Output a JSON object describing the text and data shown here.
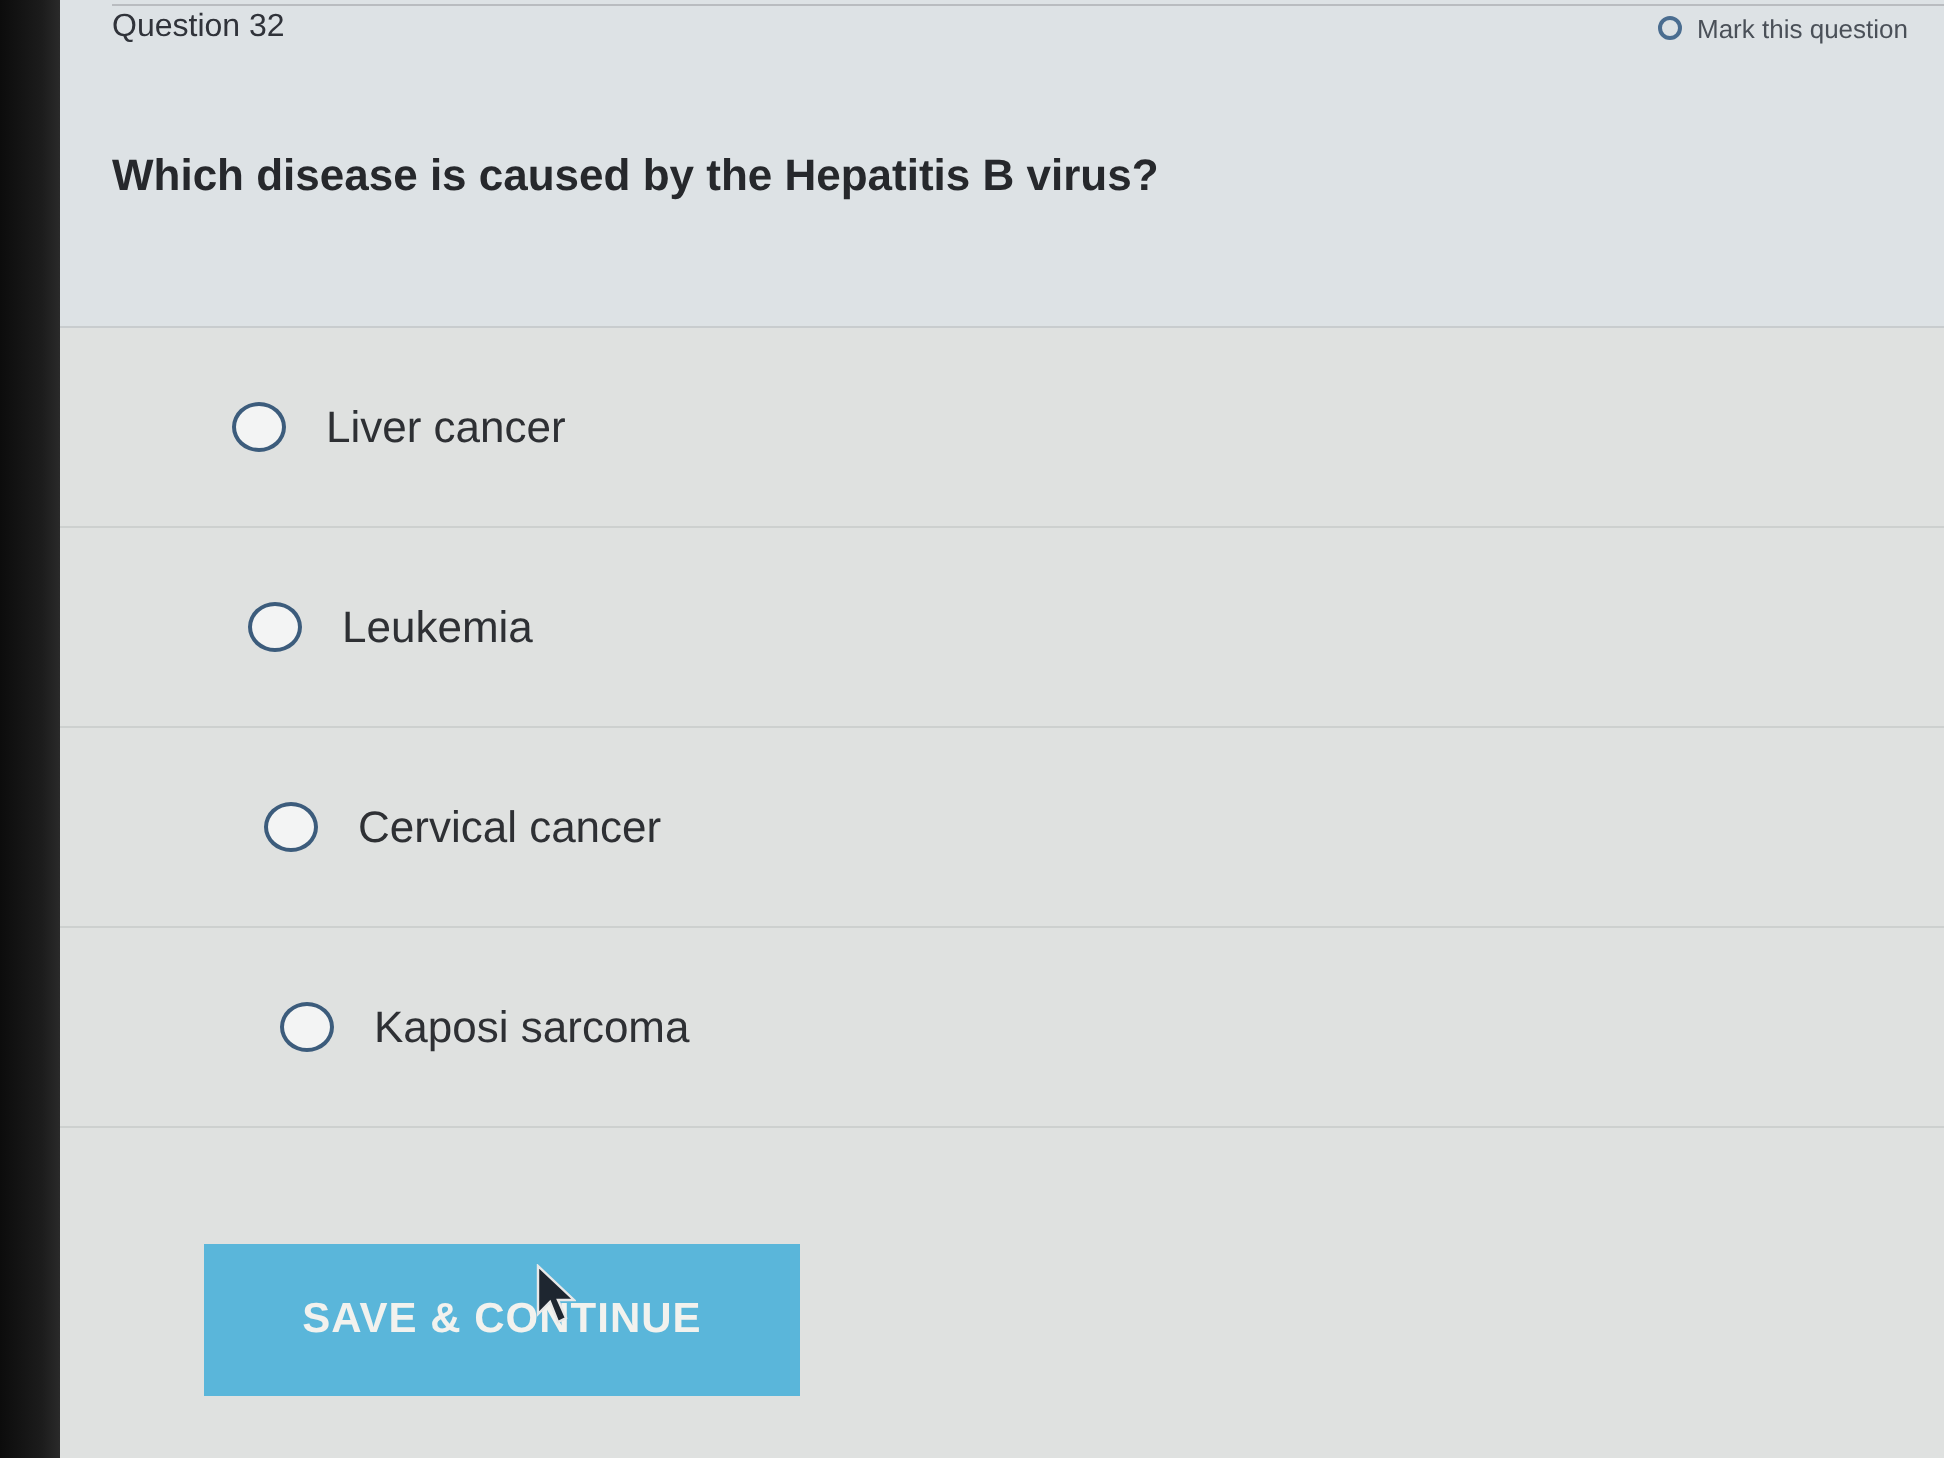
{
  "header": {
    "title": "Question 32",
    "mark_question": {
      "label": "Mark this question",
      "checked": false
    }
  },
  "question": {
    "text": "Which disease is caused by the Hepatitis B virus?"
  },
  "options": [
    {
      "label": "Liver cancer",
      "selected": false
    },
    {
      "label": "Leukemia",
      "selected": false
    },
    {
      "label": "Cervical cancer",
      "selected": false
    },
    {
      "label": "Kaposi sarcoma",
      "selected": false
    }
  ],
  "button": {
    "label": "SAVE & CONTINUE"
  }
}
